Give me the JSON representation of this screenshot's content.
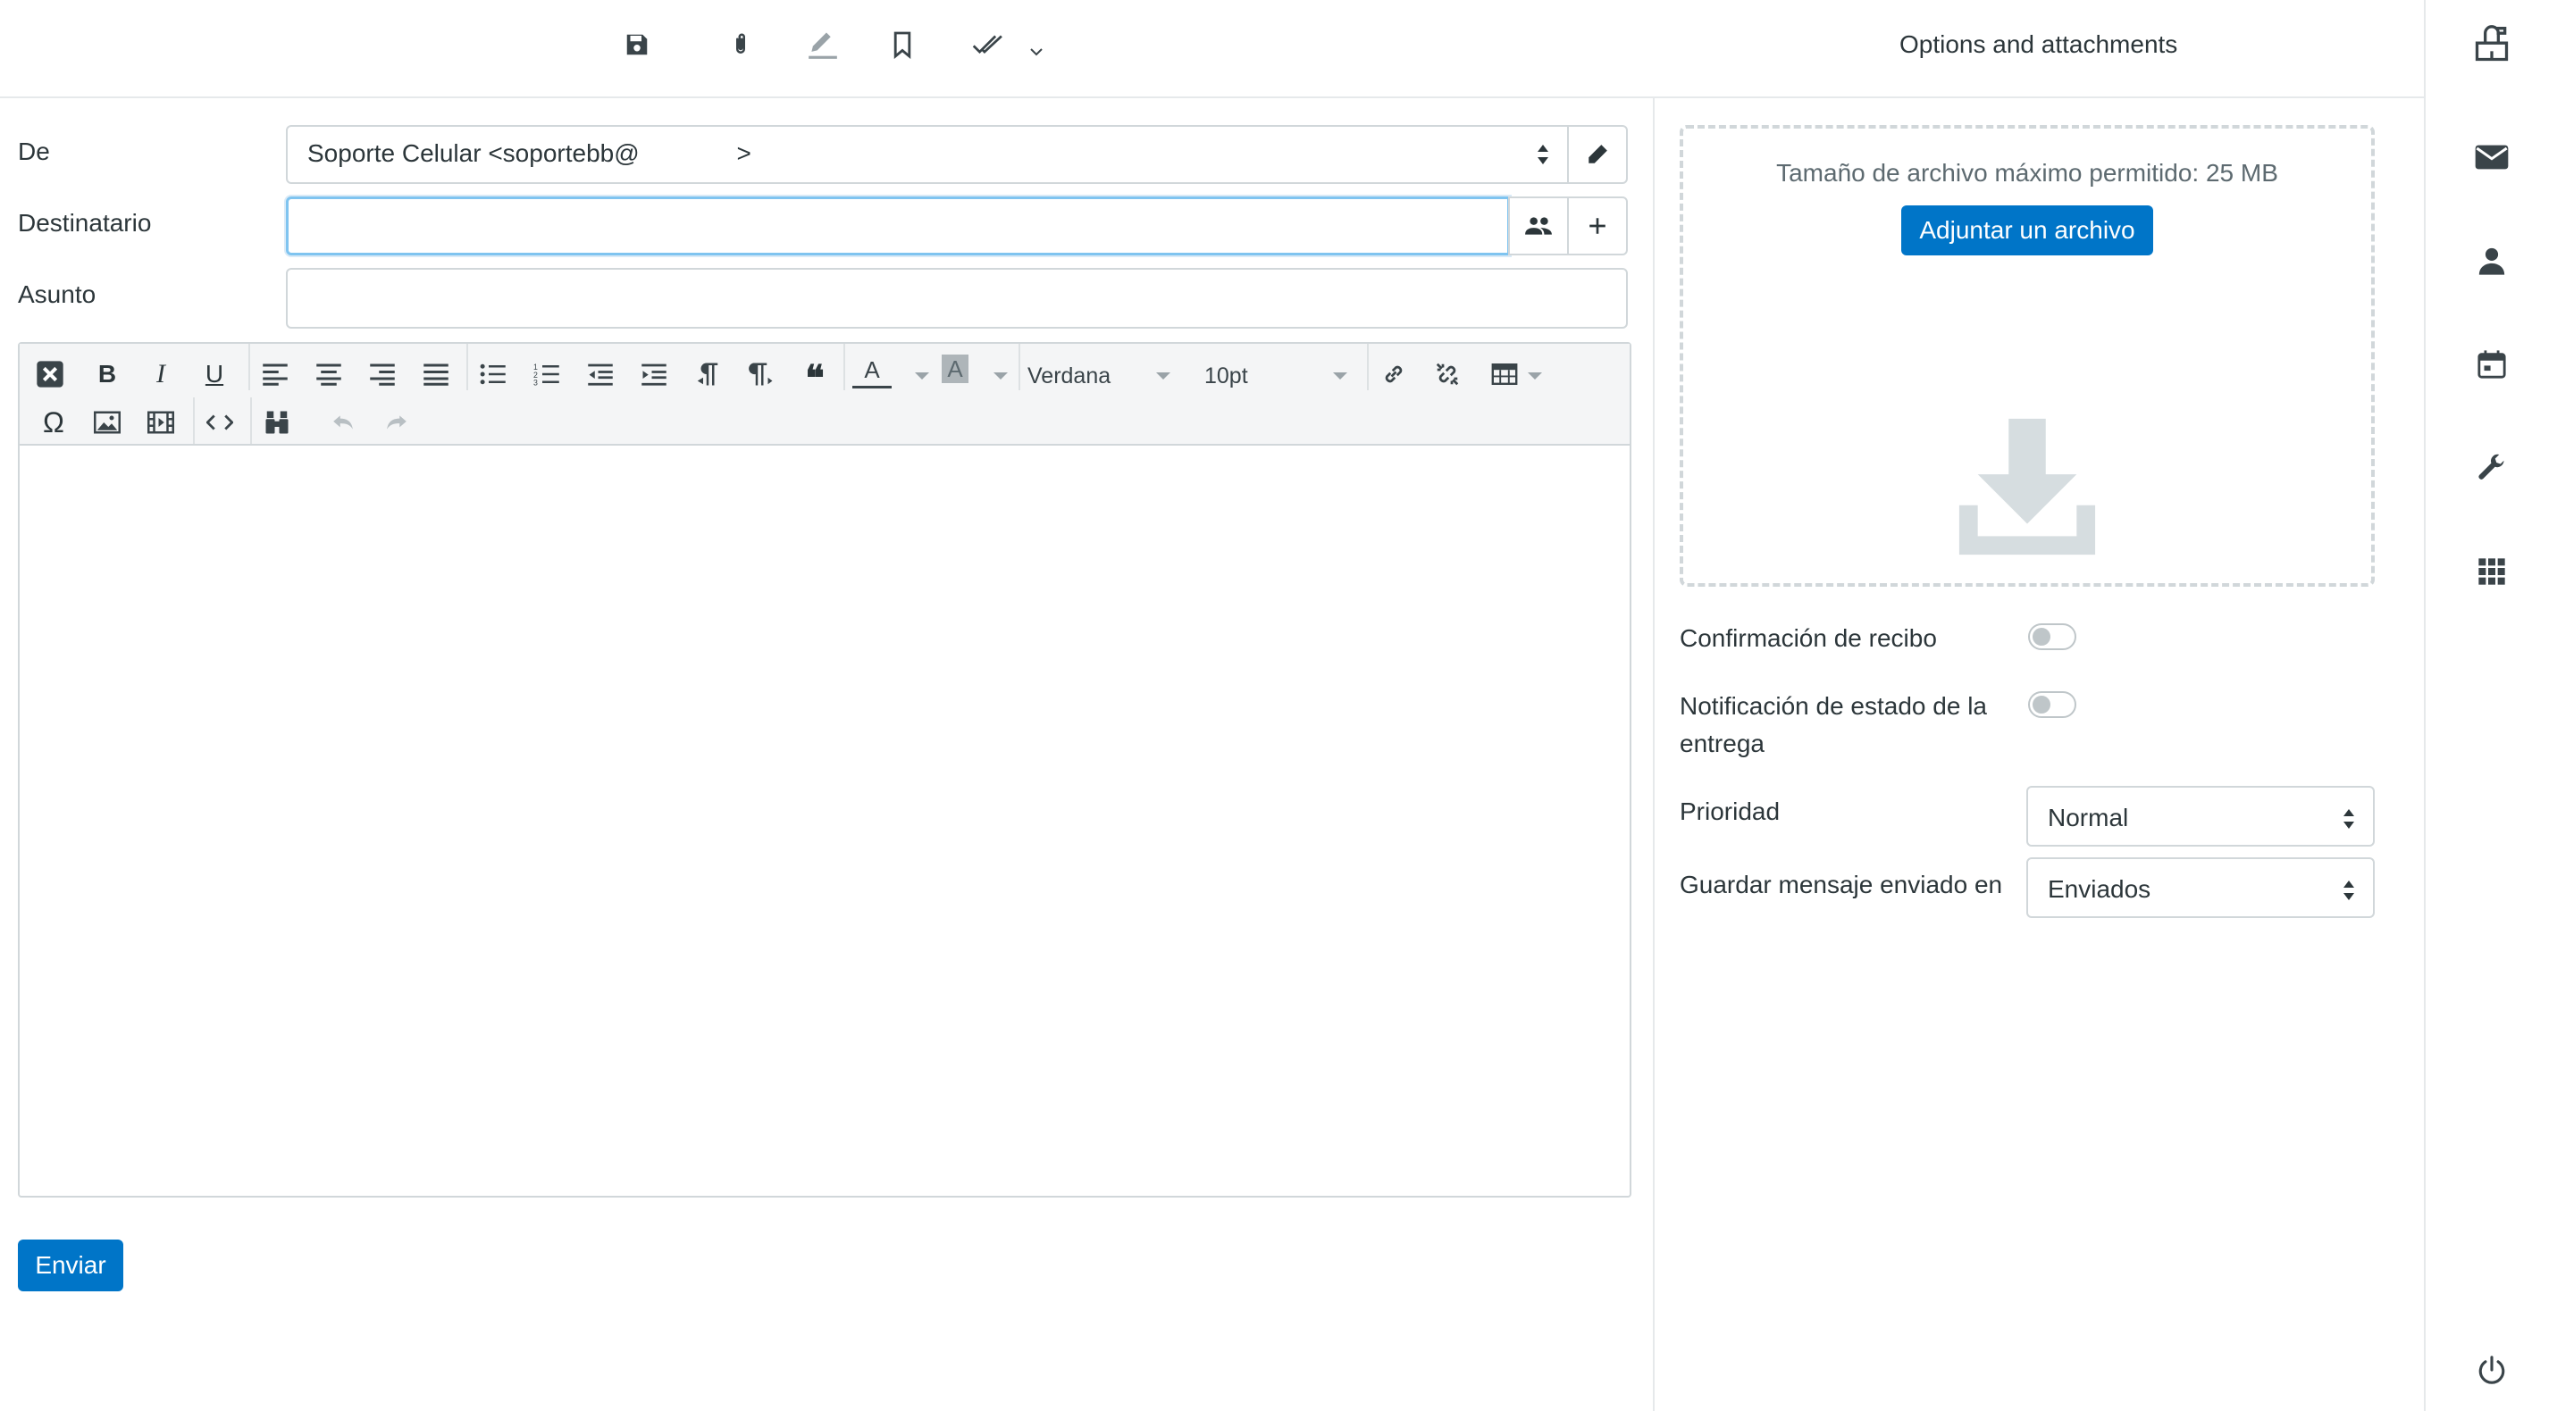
{
  "toolbar": {
    "icons": [
      "save-icon",
      "paperclip-icon",
      "signature-icon",
      "bookmark-icon",
      "double-check-icon",
      "chevron-down-icon"
    ],
    "panel_title": "Options and attachments"
  },
  "compose": {
    "from_label": "De",
    "from_value": "Soporte Celular <soportebb@              >",
    "to_label": "Destinatario",
    "to_value": "",
    "subject_label": "Asunto",
    "subject_value": "",
    "send_label": "Enviar"
  },
  "editor": {
    "font_family": "Verdana",
    "font_size": "10pt",
    "tools_row1": [
      "clear-format-icon",
      "bold-icon",
      "italic-icon",
      "underline-icon",
      "align-left-icon",
      "align-center-icon",
      "align-right-icon",
      "align-justify-icon",
      "bullet-list-icon",
      "numbered-list-icon",
      "outdent-icon",
      "indent-icon",
      "ltr-icon",
      "rtl-icon",
      "blockquote-icon",
      "text-color-icon",
      "background-color-icon",
      "link-icon",
      "unlink-icon",
      "table-icon"
    ],
    "tools_row2": [
      "special-char-icon",
      "image-icon",
      "media-icon",
      "source-code-icon",
      "find-replace-icon",
      "undo-icon",
      "redo-icon"
    ],
    "bold_glyph": "B",
    "italic_glyph": "I",
    "underline_glyph": "U",
    "omega_glyph": "Ω",
    "quote_glyph": "❝",
    "text_color_glyph": "A"
  },
  "options": {
    "max_size_text": "Tamaño de archivo máximo permitido: 25 MB",
    "attach_button": "Adjuntar un archivo",
    "return_receipt_label": "Confirmación de recibo",
    "return_receipt_on": false,
    "dsn_label": "Notificación de estado de la entrega",
    "dsn_on": false,
    "priority_label": "Prioridad",
    "priority_value": "Normal",
    "save_in_label": "Guardar mensaje enviado en",
    "save_in_value": "Enviados"
  },
  "nav": {
    "items": [
      "mail-icon",
      "contacts-icon",
      "calendar-icon",
      "settings-icon",
      "apps-icon"
    ],
    "bottom": "logout-icon",
    "top": "mailbox-icon"
  },
  "colors": {
    "primary": "#0075c8",
    "focus_border": "#7fc4f0",
    "border": "#d1d7da",
    "icon": "#3a4449"
  }
}
